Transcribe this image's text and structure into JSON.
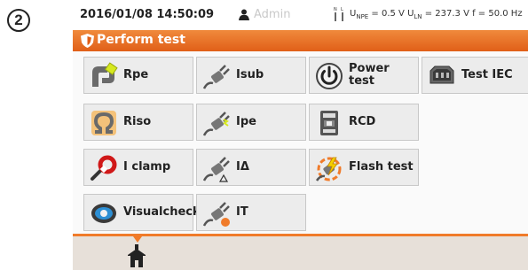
{
  "step_marker": "2",
  "status": {
    "datetime": "2016/01/08 14:50:09",
    "user": "Admin",
    "meas_icon_label": "N L",
    "u_npe_sym": "U",
    "u_npe_sub": "NPE",
    "u_npe_val": " = 0.5 V ",
    "u_ln_sym": "U",
    "u_ln_sub": "LN",
    "u_ln_val": " = 237.3 V ",
    "freq": "f = 50.0 Hz"
  },
  "title": "Perform test",
  "tests": [
    {
      "label": "Rpe",
      "icon": "rpe-icon"
    },
    {
      "label": "Isub",
      "icon": "plug-icon"
    },
    {
      "label": "Power test",
      "icon": "power-icon"
    },
    {
      "label": "Test IEC",
      "icon": "iec-connector-icon"
    },
    {
      "label": "Riso",
      "icon": "riso-icon"
    },
    {
      "label": "Ipe",
      "icon": "plug-spark-icon"
    },
    {
      "label": "RCD",
      "icon": "rcd-icon"
    },
    {
      "label": "I clamp",
      "icon": "clamp-icon"
    },
    {
      "label": "IΔ",
      "icon": "plug-delta-icon"
    },
    {
      "label": "Flash test",
      "icon": "flash-icon"
    },
    {
      "label_line1": "Visual",
      "label_line2": "check",
      "icon": "eye-icon"
    },
    {
      "label": "IT",
      "icon": "plug-it-icon"
    }
  ],
  "nav": {
    "home_icon": "home-icon"
  },
  "colors": {
    "accent": "#f07b2a",
    "tile_bg": "#ececec",
    "nav_bg": "#e7e0d9"
  }
}
